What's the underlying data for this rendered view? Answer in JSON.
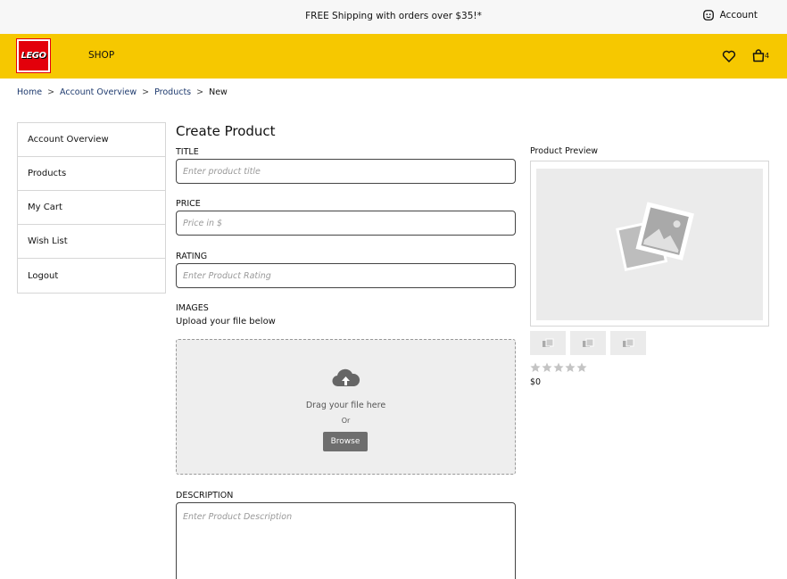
{
  "promo": {
    "text": "FREE Shipping with orders over $35!*"
  },
  "account": {
    "label": "Account",
    "icon": "account-icon"
  },
  "header": {
    "logo_text": "LEGO",
    "nav_shop": "SHOP",
    "wishlist_icon": "heart-icon",
    "bag_icon": "bag-icon",
    "bag_count": "4",
    "brand_color": "#f6c800",
    "logo_color": "#e3000b"
  },
  "breadcrumb": {
    "items": [
      "Home",
      "Account Overview",
      "Products",
      "New"
    ],
    "separator": ">"
  },
  "sidebar": {
    "items": [
      {
        "label": "Account Overview"
      },
      {
        "label": "Products"
      },
      {
        "label": "My Cart"
      },
      {
        "label": "Wish List"
      },
      {
        "label": "Logout"
      }
    ]
  },
  "form": {
    "title": "Create Product",
    "title_label": "TITLE",
    "title_placeholder": "Enter product title",
    "price_label": "PRICE",
    "price_placeholder": "Price in $",
    "rating_label": "RATING",
    "rating_placeholder": "Enter Product Rating",
    "images_label": "IMAGES",
    "images_hint": "Upload your file below",
    "dropzone": {
      "icon": "cloud-upload-icon",
      "text": "Drag your file here",
      "or": "Or",
      "browse": "Browse"
    },
    "description_label": "DESCRIPTION",
    "description_placeholder": "Enter Product Description"
  },
  "preview": {
    "label": "Product Preview",
    "image_icon": "image-placeholder-icon",
    "thumbnails": 3,
    "rating": 0,
    "max_rating": 5,
    "price": "$0"
  }
}
